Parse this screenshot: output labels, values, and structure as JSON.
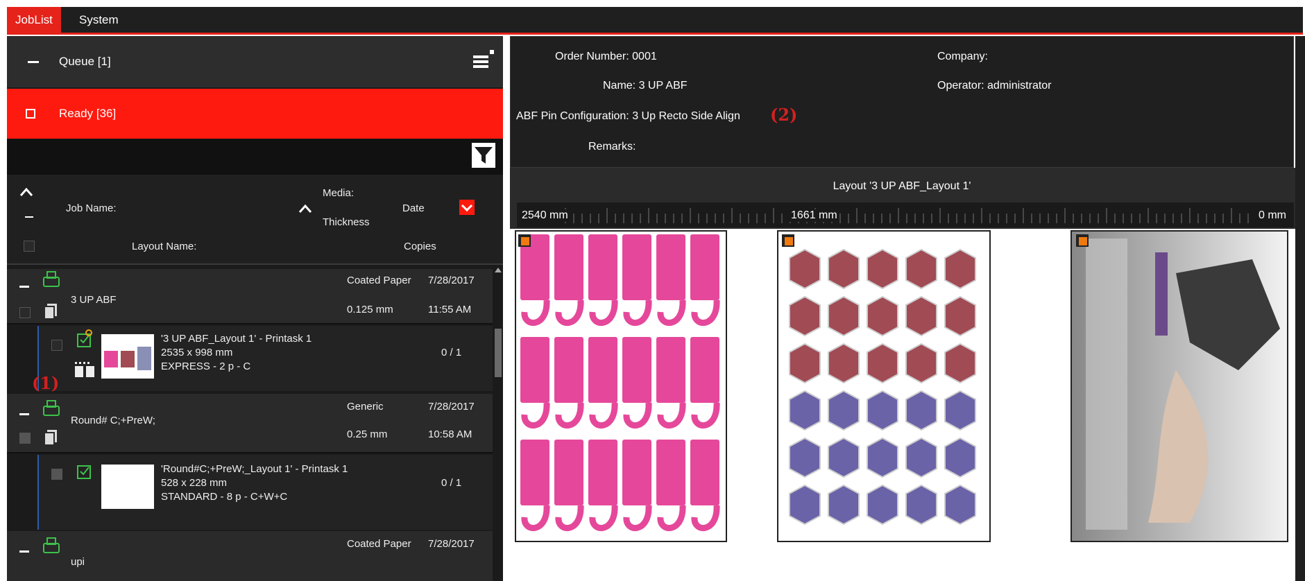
{
  "menu": {
    "joblist": "JobList",
    "system": "System"
  },
  "queue": {
    "label": "Queue [1]"
  },
  "ready": {
    "label": "Ready [36]"
  },
  "columns": {
    "job_name": "Job Name:",
    "media": "Media:",
    "thickness": "Thickness",
    "date": "Date",
    "layout_name": "Layout Name:",
    "copies": "Copies"
  },
  "jobs": [
    {
      "name": "3 UP ABF",
      "media": "Coated Paper",
      "thickness": "0.125 mm",
      "date": "7/28/2017",
      "time": "11:55 AM",
      "task": {
        "title": "'3 UP ABF_Layout 1' - Printask 1",
        "size": "2535 x 998 mm",
        "mode": "EXPRESS - 2 p - C",
        "copies": "0 / 1"
      }
    },
    {
      "name": "Round# C;+PreW;",
      "media": "Generic",
      "thickness": "0.25 mm",
      "date": "7/28/2017",
      "time": "10:58 AM",
      "task": {
        "title": "'Round#C;+PreW;_Layout 1' - Printask 1",
        "size": "528 x 228 mm",
        "mode": "STANDARD - 8 p - C+W+C",
        "copies": "0 / 1"
      }
    },
    {
      "name": "upi",
      "media": "Coated Paper",
      "date": "7/28/2017"
    }
  ],
  "annotations": {
    "one": "(1)",
    "two": "(2)"
  },
  "order": {
    "number": "Order Number: 0001",
    "company": "Company:",
    "name": "Name: 3 UP ABF",
    "operator": "Operator: administrator",
    "pin": "ABF Pin Configuration: 3 Up Recto Side Align",
    "remarks": "Remarks:"
  },
  "layout": {
    "title": "Layout '3 UP ABF_Layout 1'",
    "ruler_left": "2540 mm",
    "ruler_mid": "1661 mm",
    "ruler_right": "0 mm"
  },
  "colors": {
    "accent": "#e5231b",
    "magenta": "#e5489a",
    "maroon": "#a14b55",
    "purple": "#6a63a8",
    "orange": "#ee7a10"
  }
}
